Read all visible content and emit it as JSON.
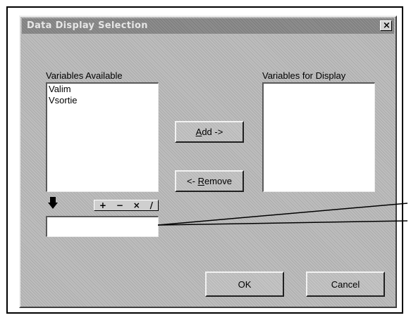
{
  "dialog": {
    "title": "Data Display Selection",
    "close_label": "×"
  },
  "available": {
    "label": "Variables Available",
    "items": [
      "Valim",
      "Vsortie"
    ]
  },
  "display": {
    "label": "Variables for Display",
    "items": []
  },
  "buttons": {
    "add_prefix": "",
    "add_accel": "A",
    "add_rest": "dd ->",
    "remove_prefix": "<- ",
    "remove_accel": "R",
    "remove_rest": "emove",
    "ok": "OK",
    "cancel": "Cancel"
  },
  "operators": {
    "plus": "+",
    "minus": "−",
    "times": "×",
    "divide": "/"
  },
  "expression": {
    "value": ""
  },
  "icons": {
    "insert_arrow": "arrow-down-icon"
  }
}
